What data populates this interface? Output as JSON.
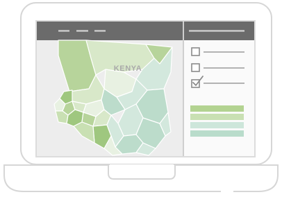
{
  "map": {
    "country_label": "KENYA"
  },
  "colors": {
    "laptop_outline": "#d6d6d6",
    "screen_frame": "#dcdcdc",
    "titlebar": "#6b6b6b",
    "titlebar_lines": "#d4d4d4",
    "map_background": "#ededed",
    "region_light_green": "#d8e8c9",
    "region_mid_green": "#b7d49b",
    "region_dark_green": "#9fc77f",
    "region_mint": "#d3e8dd",
    "region_teal": "#bcdccb",
    "region_pale": "#e8f1e2",
    "label_gray": "#a9a9a9",
    "checkbox_gray": "#8a8a8a",
    "bar_green_1": "#b3d391",
    "bar_green_2": "#c9e0b3",
    "bar_mint_1": "#cde6da",
    "bar_mint_2": "#b9dccb"
  },
  "sidebar": {
    "checklist": [
      {
        "checked": false
      },
      {
        "checked": false
      },
      {
        "checked": true
      }
    ],
    "bars": [
      {
        "color": "bar_green_1"
      },
      {
        "color": "bar_green_2"
      },
      {
        "color": "bar_mint_1"
      },
      {
        "color": "bar_mint_2"
      }
    ]
  },
  "icons": {
    "laptop": "laptop-icon",
    "checkbox": "checkbox-icon",
    "checkmark": "checkmark-icon",
    "map": "kenya-map-icon"
  }
}
